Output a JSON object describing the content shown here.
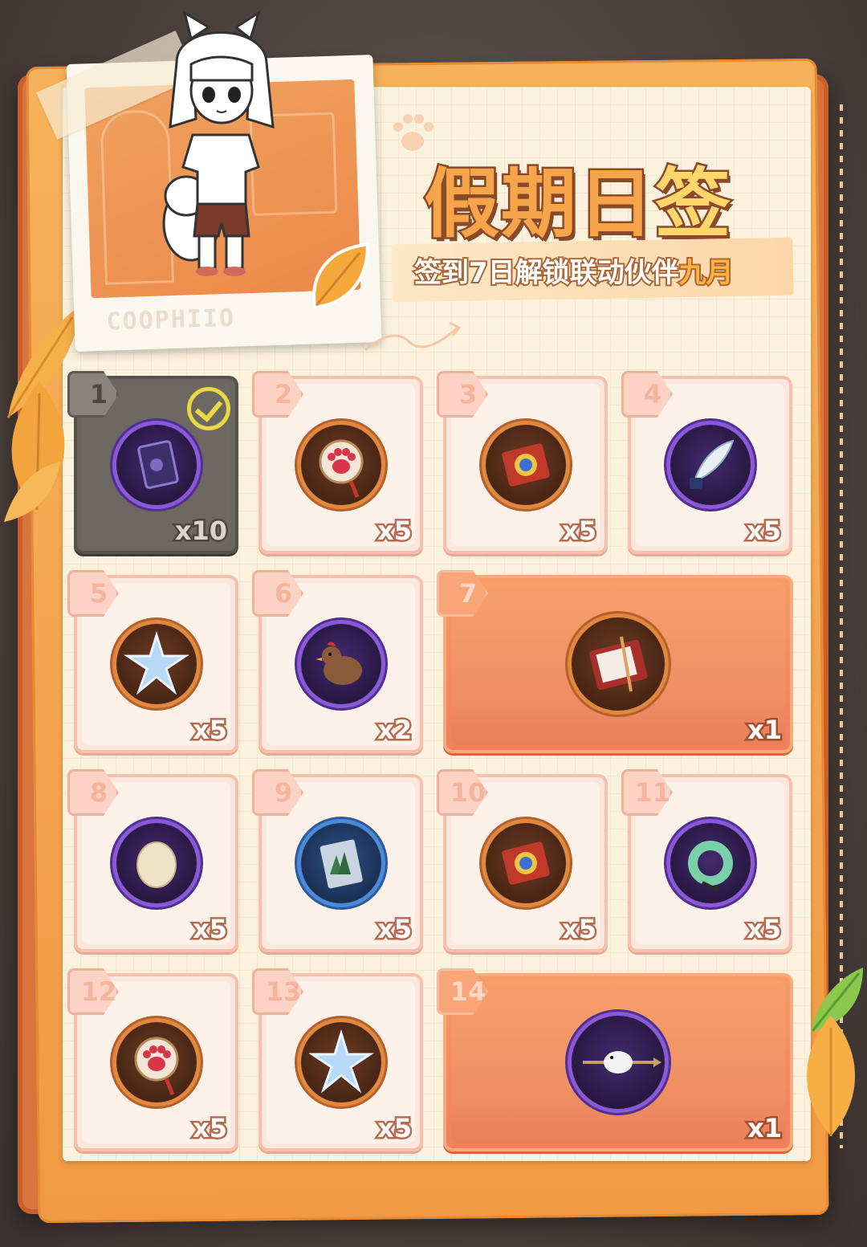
{
  "event": {
    "title_main": "假期日",
    "title_highlight": "签",
    "subtitle_prefix": "签到7日解锁联动伙伴",
    "subtitle_highlight": "九月",
    "polaroid_caption": "COOPHIIO"
  },
  "rewards": [
    {
      "day": "1",
      "qty": "x10",
      "icon": "purple-card-icon",
      "claimed": true
    },
    {
      "day": "2",
      "qty": "x5",
      "icon": "paw-pendant-icon",
      "claimed": false
    },
    {
      "day": "3",
      "qty": "x5",
      "icon": "ticket-icon",
      "claimed": false
    },
    {
      "day": "4",
      "qty": "x5",
      "icon": "quill-ink-icon",
      "claimed": false
    },
    {
      "day": "5",
      "qty": "x5",
      "icon": "crystal-star-icon",
      "claimed": false
    },
    {
      "day": "6",
      "qty": "x2",
      "icon": "chicken-icon",
      "claimed": false
    },
    {
      "day": "7",
      "qty": "x1",
      "icon": "gift-box-icon",
      "claimed": false
    },
    {
      "day": "8",
      "qty": "x5",
      "icon": "egg-icon",
      "claimed": false
    },
    {
      "day": "9",
      "qty": "x5",
      "icon": "forest-card-icon",
      "claimed": false
    },
    {
      "day": "10",
      "qty": "x5",
      "icon": "ticket-icon",
      "claimed": false
    },
    {
      "day": "11",
      "qty": "x5",
      "icon": "jade-pendant-icon",
      "claimed": false
    },
    {
      "day": "12",
      "qty": "x5",
      "icon": "paw-pendant-icon",
      "claimed": false
    },
    {
      "day": "13",
      "qty": "x5",
      "icon": "crystal-star-icon",
      "claimed": false
    },
    {
      "day": "14",
      "qty": "x1",
      "icon": "seal-arrow-icon",
      "claimed": false
    }
  ],
  "colors": {
    "accent": "#f7a54a",
    "card_bg": "#fde6dc",
    "big_card_bg": "#f0805a",
    "claimed_bg": "#6c6660",
    "check": "#e8d746"
  }
}
